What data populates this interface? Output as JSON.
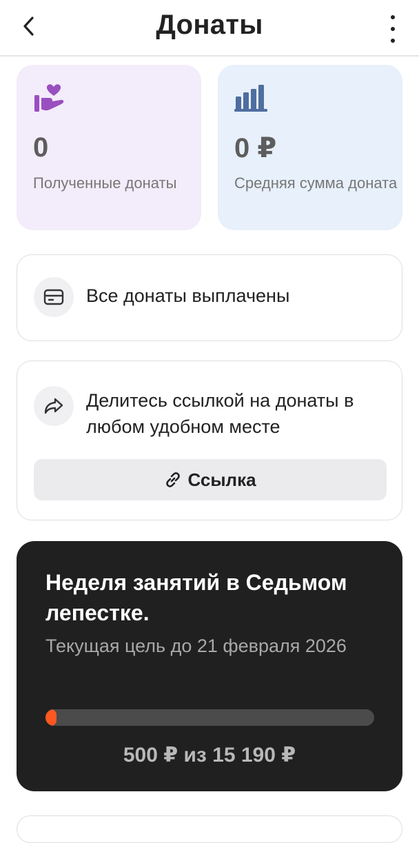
{
  "header": {
    "title": "Донаты",
    "back_icon": "chevron-left-icon",
    "more_icon": "more-vertical-icon"
  },
  "stats": {
    "received": {
      "value": "0",
      "label": "Полученные донаты",
      "icon": "hand-heart-icon",
      "bg_color": "#f3ecfa",
      "icon_color": "#9a4fc0"
    },
    "average": {
      "value": "0 ₽",
      "label": "Средняя сумма доната",
      "icon": "bar-chart-icon",
      "bg_color": "#e7f0fb",
      "icon_color": "#4f6e9f"
    }
  },
  "payout": {
    "text": "Все донаты выплачены",
    "icon": "card-icon"
  },
  "share": {
    "text": "Делитесь ссылкой на донаты в любом удобном месте",
    "icon": "share-arrow-icon",
    "button_label": "Ссылка",
    "button_icon": "link-icon"
  },
  "goal": {
    "title": "Неделя занятий в Седьмом лепестке.",
    "subtitle": "Текущая цель до 21 февраля 2026",
    "amount_text": "500 ₽ из 15 190 ₽",
    "progress_fraction": 0.033,
    "progress_color": "#ff5722"
  }
}
